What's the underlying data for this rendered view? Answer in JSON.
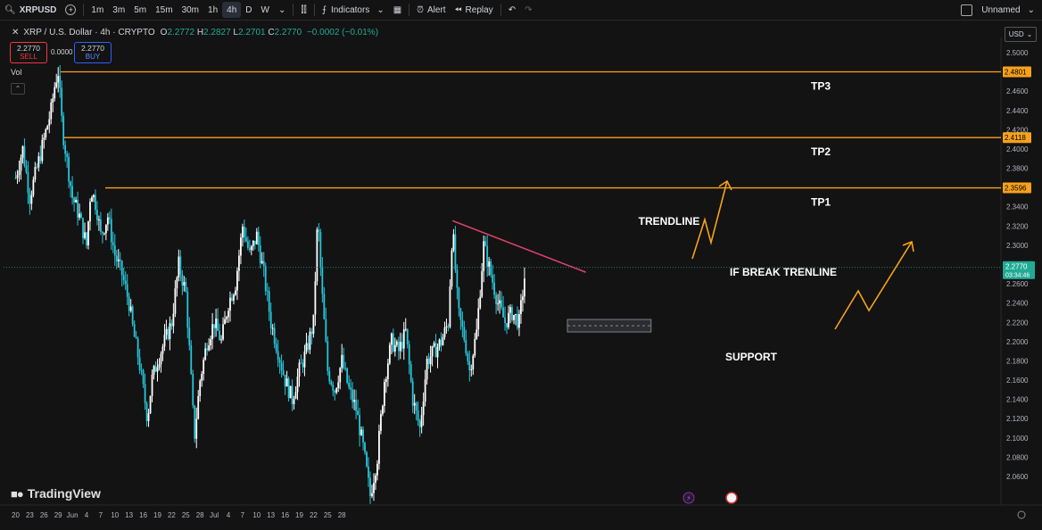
{
  "toolbar": {
    "symbol": "XRPUSD",
    "intervals": [
      "1m",
      "3m",
      "5m",
      "15m",
      "30m",
      "1h",
      "4h",
      "D",
      "W"
    ],
    "active_interval": "4h",
    "indicators_label": "Indicators",
    "alert_label": "Alert",
    "replay_label": "Replay",
    "layout_name": "Unnamed"
  },
  "legend": {
    "title": "XRP / U.S. Dollar · 4h · CRYPTO",
    "open_label": "O",
    "open": "2.2772",
    "high_label": "H",
    "high": "2.2827",
    "low_label": "L",
    "low": "2.2701",
    "close_label": "C",
    "close": "2.2770",
    "change": "−0.0002 (−0.01%)"
  },
  "trade": {
    "sell_price": "2.2770",
    "sell_label": "SELL",
    "buy_price": "2.2770",
    "buy_label": "BUY",
    "spread": "0.0000"
  },
  "volume_label": "Vol",
  "brand": "TradingView",
  "currency": "USD",
  "colors": {
    "background": "#131313",
    "up": "#ffffff",
    "down": "#26c6da",
    "target_lines": "#f7a21b",
    "trendline": "#e0436b",
    "arrows": "#f7a21b",
    "price_label": "#22ab94"
  },
  "chart_data": {
    "type": "candlestick",
    "y_ticks": [
      "2.5000",
      "2.4800",
      "2.4600",
      "2.4400",
      "2.4200",
      "2.4000",
      "2.3800",
      "2.3600",
      "2.3400",
      "2.3200",
      "2.3000",
      "2.2800",
      "2.2600",
      "2.2400",
      "2.2200",
      "2.2000",
      "2.1800",
      "2.1600",
      "2.1400",
      "2.1200",
      "2.1000",
      "2.0800",
      "2.0600"
    ],
    "ylim": [
      2.044,
      2.508
    ],
    "x_ticks": [
      "20",
      "23",
      "26",
      "29",
      "Jun",
      "4",
      "7",
      "10",
      "13",
      "16",
      "19",
      "22",
      "25",
      "28",
      "Jul",
      "4",
      "7",
      "10",
      "13",
      "16",
      "19",
      "22",
      "25",
      "28"
    ],
    "levels": [
      {
        "label": "TP3",
        "price": 2.4801,
        "tag": "2.4801"
      },
      {
        "label": "TP2",
        "price": 2.4118,
        "tag": "2.4118"
      },
      {
        "label": "TP1",
        "price": 2.3596,
        "tag": "2.3596"
      }
    ],
    "current_price": {
      "value": 2.277,
      "tag": "2.2770",
      "countdown": "03:34:46"
    },
    "annotations": {
      "trendline": "TRENDLINE",
      "break": "IF BREAK TRENLINE",
      "support": "SUPPORT"
    },
    "trendline": {
      "from_x": 30.8,
      "from_price": 2.3255,
      "to_x": 40.2,
      "to_price": 2.272
    },
    "support_zone": {
      "x_start": 38.9,
      "x_end": 44.8,
      "top": 2.223,
      "bottom": 2.21
    },
    "path": [
      [
        0,
        2.37
      ],
      [
        0.5,
        2.4
      ],
      [
        1,
        2.35
      ],
      [
        1.5,
        2.38
      ],
      [
        2,
        2.41
      ],
      [
        2.5,
        2.44
      ],
      [
        2.8,
        2.47
      ],
      [
        3,
        2.48
      ],
      [
        3.3,
        2.42
      ],
      [
        3.7,
        2.38
      ],
      [
        4,
        2.35
      ],
      [
        4.5,
        2.33
      ],
      [
        5,
        2.3
      ],
      [
        5.3,
        2.36
      ],
      [
        5.7,
        2.34
      ],
      [
        6,
        2.31
      ],
      [
        6.5,
        2.33
      ],
      [
        7,
        2.29
      ],
      [
        7.5,
        2.27
      ],
      [
        8,
        2.24
      ],
      [
        8.3,
        2.21
      ],
      [
        8.7,
        2.18
      ],
      [
        9,
        2.15
      ],
      [
        9.3,
        2.12
      ],
      [
        9.6,
        2.16
      ],
      [
        10,
        2.18
      ],
      [
        10.5,
        2.2
      ],
      [
        11,
        2.22
      ],
      [
        11.5,
        2.28
      ],
      [
        12,
        2.25
      ],
      [
        12.3,
        2.18
      ],
      [
        12.6,
        2.1
      ],
      [
        13,
        2.16
      ],
      [
        13.5,
        2.2
      ],
      [
        14,
        2.22
      ],
      [
        14.5,
        2.2
      ],
      [
        15,
        2.24
      ],
      [
        15.5,
        2.26
      ],
      [
        16,
        2.32
      ],
      [
        16.5,
        2.29
      ],
      [
        17,
        2.31
      ],
      [
        17.5,
        2.27
      ],
      [
        18,
        2.22
      ],
      [
        18.5,
        2.19
      ],
      [
        19,
        2.16
      ],
      [
        19.5,
        2.14
      ],
      [
        20,
        2.17
      ],
      [
        20.5,
        2.19
      ],
      [
        21,
        2.22
      ],
      [
        21.3,
        2.33
      ],
      [
        21.6,
        2.25
      ],
      [
        22,
        2.17
      ],
      [
        22.5,
        2.15
      ],
      [
        23,
        2.18
      ],
      [
        23.5,
        2.15
      ],
      [
        24,
        2.13
      ],
      [
        24.5,
        2.09
      ],
      [
        25,
        2.04
      ],
      [
        25.5,
        2.08
      ],
      [
        26,
        2.16
      ],
      [
        26.5,
        2.2
      ],
      [
        27,
        2.19
      ],
      [
        27.5,
        2.21
      ],
      [
        28,
        2.14
      ],
      [
        28.5,
        2.11
      ],
      [
        29,
        2.18
      ],
      [
        29.5,
        2.19
      ],
      [
        30,
        2.2
      ],
      [
        30.5,
        2.22
      ],
      [
        30.8,
        2.32
      ],
      [
        31.2,
        2.23
      ],
      [
        31.7,
        2.2
      ],
      [
        32,
        2.17
      ],
      [
        32.5,
        2.21
      ],
      [
        33,
        2.3
      ],
      [
        33.5,
        2.27
      ],
      [
        34,
        2.24
      ],
      [
        34.5,
        2.22
      ],
      [
        35,
        2.23
      ],
      [
        35.5,
        2.22
      ],
      [
        35.9,
        2.27
      ]
    ]
  }
}
